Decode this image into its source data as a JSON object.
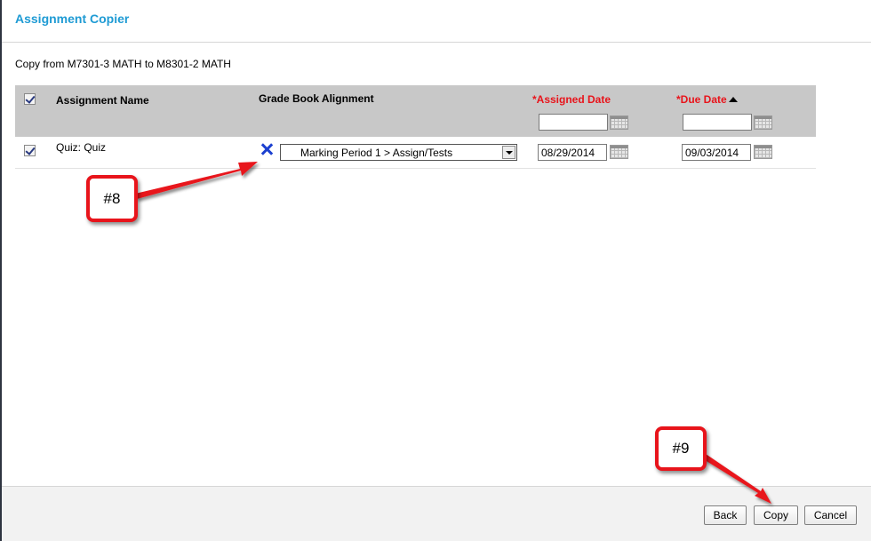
{
  "header": {
    "title": "Assignment Copier"
  },
  "copy_description": "Copy from M7301-3 MATH to M8301-2 MATH",
  "grid": {
    "columns": {
      "assignment_name": "Assignment Name",
      "grade_book_alignment": "Grade Book Alignment",
      "assigned_date_required": "*",
      "assigned_date": "Assigned Date",
      "due_date_required": "*",
      "due_date": "Due Date"
    },
    "filters": {
      "assigned_date": "",
      "due_date": ""
    },
    "select_all_checked": true,
    "rows": [
      {
        "checked": true,
        "name": "Quiz: Quiz",
        "alignment": "Marking Period 1 > Assign/Tests",
        "assigned_date": "08/29/2014",
        "due_date": "09/03/2014"
      }
    ]
  },
  "annotations": {
    "callout_8": "#8",
    "callout_9": "#9"
  },
  "footer": {
    "back_label": "Back",
    "copy_label": "Copy",
    "cancel_label": "Cancel"
  },
  "colors": {
    "title": "#1f9bd4",
    "required": "#e8141b",
    "header_bg": "#c8c8c8",
    "remove_icon": "#1c40d0",
    "callout_border": "#e8141b"
  }
}
